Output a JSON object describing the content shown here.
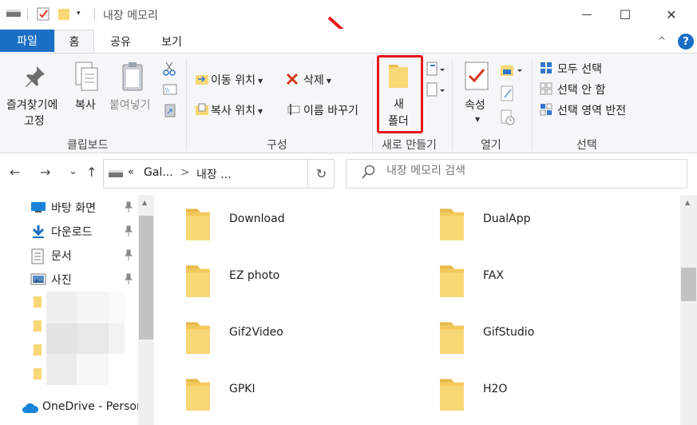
{
  "titlebar": {
    "title": "내장 메모리",
    "quick_access_caret": "▾",
    "minimize": "—",
    "maximize": "☐",
    "close": "✕"
  },
  "tabs": {
    "file": "파일",
    "home": "홈",
    "share": "공유",
    "view": "보기",
    "collapse": "^",
    "help": "?"
  },
  "ribbon": {
    "clipboard": {
      "pin_label_1": "즐겨찾기에",
      "pin_label_2": "고정",
      "copy": "복사",
      "paste": "붙여넣기",
      "group": "클립보드"
    },
    "organize": {
      "move_to": "이동 위치",
      "copy_to": "복사 위치",
      "delete": "삭제",
      "rename": "이름 바꾸기",
      "group": "구성"
    },
    "new": {
      "new_folder_1": "새",
      "new_folder_2": "폴더",
      "group": "새로 만들기"
    },
    "open": {
      "properties": "속성",
      "group": "열기"
    },
    "select": {
      "select_all": "모두 선택",
      "select_none": "선택 안 함",
      "invert": "선택 영역 반전",
      "group": "선택"
    }
  },
  "address": {
    "back": "←",
    "forward": "→",
    "recent": "⌄",
    "up": "↑",
    "overflow": "«",
    "crumb_1": "Gal...",
    "sep": ">",
    "crumb_2": "내장 ...",
    "refresh": "↻"
  },
  "search": {
    "placeholder": "내장 메모리 검색"
  },
  "navpane": {
    "items": [
      {
        "label": "바탕 화면",
        "icon": "desktop-icon"
      },
      {
        "label": "다운로드",
        "icon": "download-icon"
      },
      {
        "label": "문서",
        "icon": "document-icon"
      },
      {
        "label": "사진",
        "icon": "pictures-icon"
      }
    ],
    "onedrive": "OneDrive - Person"
  },
  "files": [
    {
      "name": "Download"
    },
    {
      "name": "DualApp"
    },
    {
      "name": "EZ photo"
    },
    {
      "name": "FAX"
    },
    {
      "name": "Gif2Video"
    },
    {
      "name": "GifStudio"
    },
    {
      "name": "GPKI"
    },
    {
      "name": "H2O"
    }
  ],
  "colors": {
    "accent": "#1a6fc4",
    "folder": "#f8d775",
    "highlight": "#e8161b"
  }
}
